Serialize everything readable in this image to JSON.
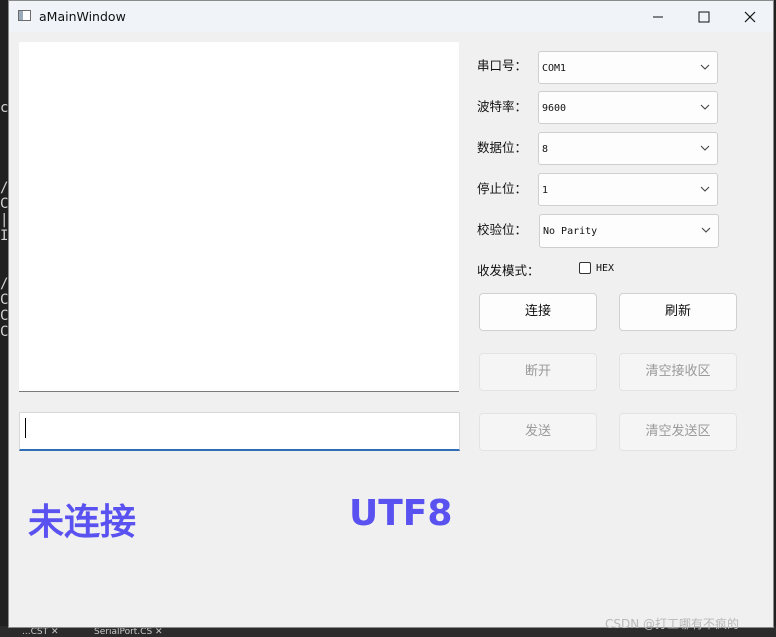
{
  "window": {
    "title": "aMainWindow"
  },
  "serial": {
    "port_label": "串口号：",
    "port_value": "COM1",
    "baud_label": "波特率：",
    "baud_value": "9600",
    "databits_label": "数据位：",
    "databits_value": "8",
    "stopbits_label": "停止位：",
    "stopbits_value": "1",
    "parity_label": "校验位：",
    "parity_value": "No Parity",
    "mode_label": "收发模式：",
    "hex_label": "HEX"
  },
  "buttons": {
    "connect": "连接",
    "refresh": "刷新",
    "disconnect": "断开",
    "clear_receive": "清空接收区",
    "send": "发送",
    "clear_send": "清空发送区"
  },
  "status": {
    "connection": "未连接",
    "encoding": "UTF8"
  },
  "watermark": "CSDN @打工哪有不疯的",
  "background": {
    "tab1": "...CST ✕",
    "tab2": "SerialPort.CS ✕"
  },
  "colors": {
    "status": "#5a52f0",
    "accent": "#2f6db5"
  }
}
